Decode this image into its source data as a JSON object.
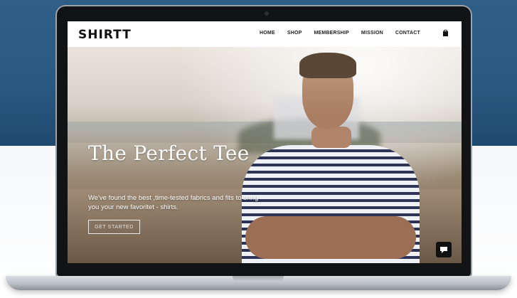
{
  "site": {
    "logo": "SHIRTT",
    "nav": [
      "HOME",
      "SHOP",
      "MEMBERSHIP",
      "MISSION",
      "CONTACT"
    ],
    "cart_icon": "shopping-bag-icon"
  },
  "hero": {
    "title": "The Perfect Tee",
    "text": "We've found the best ,time-tested fabrics and fits to bring you your new favoritet - shirts.",
    "cta": "GET STARTED",
    "chat_icon": "chat-bubble-icon"
  },
  "colors": {
    "background_top": "#2f5f86",
    "laptop_frame": "#121315",
    "header": "#ffffff",
    "text_on_hero": "#ffffff"
  }
}
